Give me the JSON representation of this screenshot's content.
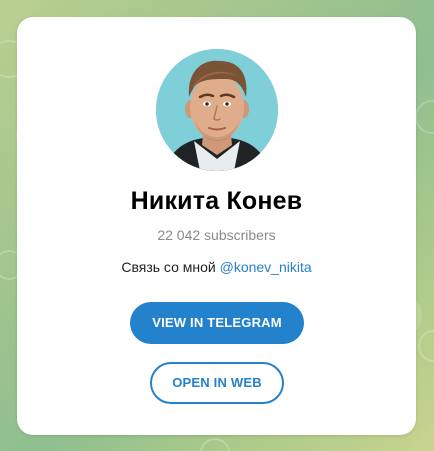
{
  "channel": {
    "name": "Никита Конев",
    "subscribers": "22 042 subscribers",
    "description_text": "Связь со мной ",
    "description_link": "@konev_nikita"
  },
  "buttons": {
    "view_in_telegram": "VIEW IN TELEGRAM",
    "open_in_web": "OPEN IN WEB"
  },
  "colors": {
    "accent": "#2481cc",
    "avatar_bg": "#7fcfd9",
    "muted_text": "#8a8a8a"
  },
  "icons": {
    "avatar": "profile-photo"
  }
}
